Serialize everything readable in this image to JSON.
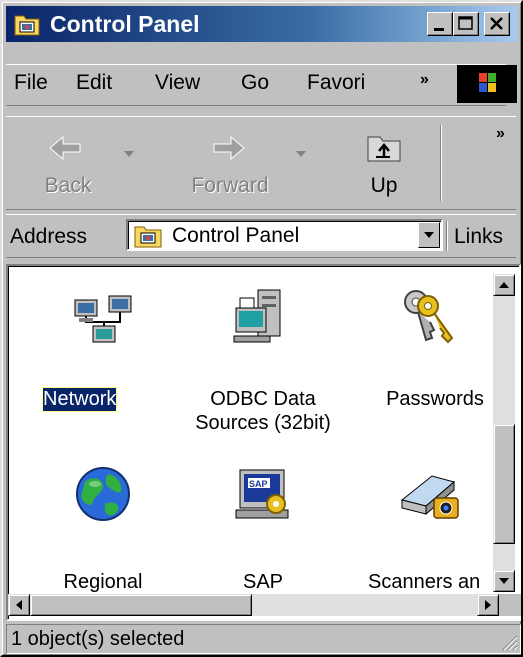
{
  "window": {
    "title": "Control Panel",
    "icon": "control-panel-icon"
  },
  "menu": {
    "file": "File",
    "edit": "Edit",
    "view": "View",
    "go": "Go",
    "favorites": "Favori",
    "overflow": "»"
  },
  "toolbar": {
    "back": "Back",
    "forward": "Forward",
    "up": "Up",
    "overflow": "»"
  },
  "address": {
    "label": "Address",
    "value": "Control Panel",
    "links": "Links"
  },
  "items": [
    {
      "line1": "Network",
      "line2": "",
      "icon": "network-icon",
      "selected": true
    },
    {
      "line1": "ODBC Data",
      "line2": "Sources (32bit)",
      "icon": "odbc-icon",
      "selected": false
    },
    {
      "line1": "Passwords",
      "line2": "",
      "icon": "keys-icon",
      "selected": false
    },
    {
      "line1": "Regional",
      "line2": "",
      "icon": "globe-icon",
      "selected": false
    },
    {
      "line1": "SAP",
      "line2": "",
      "icon": "sap-icon",
      "selected": false
    },
    {
      "line1": "Scanners an",
      "line2": "",
      "icon": "scanner-icon",
      "selected": false
    }
  ],
  "status": {
    "text": "1 object(s) selected"
  },
  "colors": {
    "title_active": "#0a246a",
    "face": "#c0c0c0"
  }
}
